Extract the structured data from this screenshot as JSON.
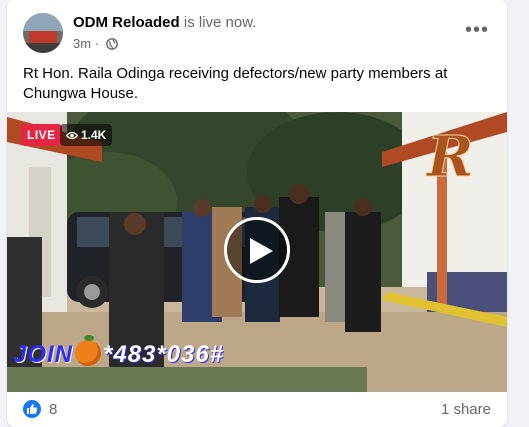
{
  "post": {
    "page_name": "ODM Reloaded",
    "status_text": "is live now.",
    "time_ago": "3m",
    "separator": "·",
    "privacy_icon": "globe-icon",
    "more_icon": "more-options-icon",
    "more_glyph": "•••",
    "text": "Rt Hon. Raila Odinga receiving defectors/new party members at Chungwa House."
  },
  "video": {
    "live_label": "LIVE",
    "viewer_count": "1.4K",
    "play_icon": "play-icon",
    "overlay_text_prefix": "JOIN",
    "overlay_text_suffix": "*483*036#",
    "logo_letter": "R",
    "colors": {
      "live": "#e42645",
      "overlay_text": "#2b2bff"
    }
  },
  "footer": {
    "reaction_icon": "like-icon",
    "reaction_count": "8",
    "share_count": "1 share"
  },
  "colors": {
    "accent": "#1877f2",
    "text_primary": "#050505",
    "text_secondary": "#65676b"
  }
}
